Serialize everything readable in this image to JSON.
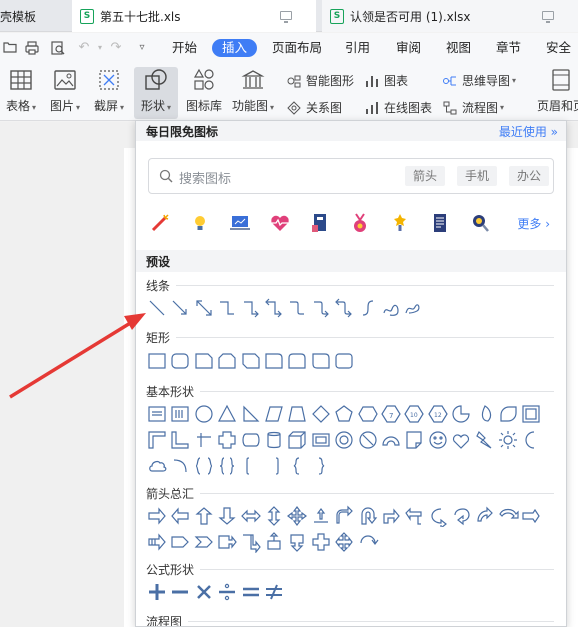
{
  "tabs": [
    {
      "label": "壳模板"
    },
    {
      "label": "第五十七批.xls"
    },
    {
      "label": "认领是否可用 (1).xlsx"
    }
  ],
  "menu": {
    "items": [
      "开始",
      "插入",
      "页面布局",
      "引用",
      "审阅",
      "视图",
      "章节",
      "安全"
    ],
    "active_index": 1
  },
  "ribbon": {
    "table": "表格",
    "picture": "图片",
    "screenshot": "截屏",
    "shape": "形状",
    "icon_lib": "图标库",
    "func_chart": "功能图",
    "smart_graphic": "智能图形",
    "chart": "图表",
    "mind_map": "思维导图",
    "relation_map": "关系图",
    "online_chart": "在线图表",
    "flowchart": "流程图",
    "header_footer": "页眉和页"
  },
  "panel": {
    "title": "每日限免图标",
    "recent": "最近使用",
    "search_placeholder": "搜索图标",
    "chips": [
      "箭头",
      "手机",
      "办公"
    ],
    "more": "更多",
    "preset": "预设",
    "categories": {
      "lines": "线条",
      "rect": "矩形",
      "basic": "基本形状",
      "arrows": "箭头总汇",
      "formula": "公式形状",
      "flow": "流程图"
    }
  },
  "colors": {
    "accent": "#3f7df5",
    "shape_stroke": "#4a6fa5",
    "annotation": "#e53935"
  },
  "gallery_icons": [
    "firework-icon",
    "lightbulb-icon",
    "laptop-chart-icon",
    "heartbeat-icon",
    "notebook-icon",
    "medal-icon",
    "trophy-icon",
    "document-icon",
    "magnifier-icon"
  ]
}
